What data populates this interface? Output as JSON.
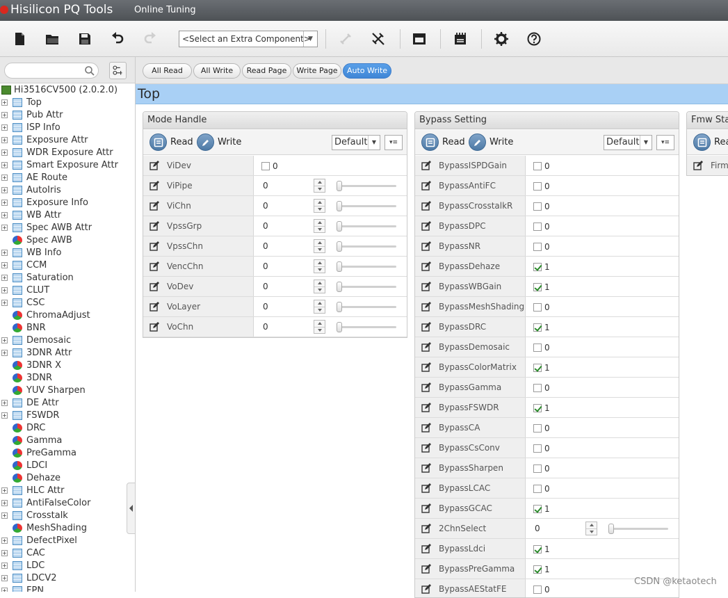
{
  "app": {
    "name": "Hisilicon PQ Tools",
    "mode": "Online Tuning"
  },
  "toolbar": {
    "icons": [
      "new-file-icon",
      "open-folder-icon",
      "save-icon",
      "undo-icon",
      "redo-icon",
      "link-icon",
      "unlink-icon",
      "window-icon",
      "register-icon",
      "gear-icon",
      "help-icon"
    ],
    "component_select": "<Select an Extra Component>"
  },
  "search": {
    "placeholder": ""
  },
  "tree": {
    "root": "Hi3516CV500 (2.0.2.0)",
    "items": [
      {
        "label": "Top",
        "icon": "grid",
        "expandable": true
      },
      {
        "label": "Pub Attr",
        "icon": "grid",
        "expandable": true
      },
      {
        "label": "ISP Info",
        "icon": "grid",
        "expandable": true
      },
      {
        "label": "Exposure Attr",
        "icon": "grid",
        "expandable": true
      },
      {
        "label": "WDR Exposure Attr",
        "icon": "grid",
        "expandable": true
      },
      {
        "label": "Smart Exposure Attr",
        "icon": "grid",
        "expandable": true
      },
      {
        "label": "AE Route",
        "icon": "grid",
        "expandable": true
      },
      {
        "label": "AutoIris",
        "icon": "grid",
        "expandable": true
      },
      {
        "label": "Exposure Info",
        "icon": "grid",
        "expandable": true
      },
      {
        "label": "WB Attr",
        "icon": "grid",
        "expandable": true
      },
      {
        "label": "Spec AWB Attr",
        "icon": "grid",
        "expandable": true
      },
      {
        "label": "Spec AWB",
        "icon": "pie",
        "expandable": false
      },
      {
        "label": "WB Info",
        "icon": "grid",
        "expandable": true
      },
      {
        "label": "CCM",
        "icon": "grid",
        "expandable": true
      },
      {
        "label": "Saturation",
        "icon": "grid",
        "expandable": true
      },
      {
        "label": "CLUT",
        "icon": "grid",
        "expandable": true
      },
      {
        "label": "CSC",
        "icon": "grid",
        "expandable": true
      },
      {
        "label": "ChromaAdjust",
        "icon": "pie",
        "expandable": false
      },
      {
        "label": "BNR",
        "icon": "pie",
        "expandable": false
      },
      {
        "label": "Demosaic",
        "icon": "grid",
        "expandable": true
      },
      {
        "label": "3DNR Attr",
        "icon": "grid",
        "expandable": true
      },
      {
        "label": "3DNR X",
        "icon": "pie",
        "expandable": false
      },
      {
        "label": "3DNR",
        "icon": "pie",
        "expandable": false
      },
      {
        "label": "YUV Sharpen",
        "icon": "pie",
        "expandable": false
      },
      {
        "label": "DE Attr",
        "icon": "grid",
        "expandable": true
      },
      {
        "label": "FSWDR",
        "icon": "grid",
        "expandable": true
      },
      {
        "label": "DRC",
        "icon": "pie",
        "expandable": false
      },
      {
        "label": "Gamma",
        "icon": "pie",
        "expandable": false
      },
      {
        "label": "PreGamma",
        "icon": "pie",
        "expandable": false
      },
      {
        "label": "LDCI",
        "icon": "pie",
        "expandable": false
      },
      {
        "label": "Dehaze",
        "icon": "pie",
        "expandable": false
      },
      {
        "label": "HLC Attr",
        "icon": "grid",
        "expandable": true
      },
      {
        "label": "AntiFalseColor",
        "icon": "grid",
        "expandable": true
      },
      {
        "label": "Crosstalk",
        "icon": "grid",
        "expandable": true
      },
      {
        "label": "MeshShading",
        "icon": "pie",
        "expandable": false
      },
      {
        "label": "DefectPixel",
        "icon": "grid",
        "expandable": true
      },
      {
        "label": "CAC",
        "icon": "grid",
        "expandable": true
      },
      {
        "label": "LDC",
        "icon": "grid",
        "expandable": true
      },
      {
        "label": "LDCV2",
        "icon": "grid",
        "expandable": true
      },
      {
        "label": "FPN",
        "icon": "grid",
        "expandable": true
      }
    ]
  },
  "actions": [
    "All Read",
    "All Write",
    "Read Page",
    "Write Page",
    "Auto Write"
  ],
  "active_action": "Auto Write",
  "section_title": "Top",
  "panels": {
    "mode_handle": {
      "title": "Mode Handle",
      "read": "Read",
      "write": "Write",
      "preset": "Default",
      "rows": [
        {
          "name": "ViDev",
          "type": "checkbox",
          "value": "0",
          "checked": false
        },
        {
          "name": "ViPipe",
          "type": "number",
          "value": "0"
        },
        {
          "name": "ViChn",
          "type": "number",
          "value": "0"
        },
        {
          "name": "VpssGrp",
          "type": "number",
          "value": "0"
        },
        {
          "name": "VpssChn",
          "type": "number",
          "value": "0"
        },
        {
          "name": "VencChn",
          "type": "number",
          "value": "0"
        },
        {
          "name": "VoDev",
          "type": "number",
          "value": "0"
        },
        {
          "name": "VoLayer",
          "type": "number",
          "value": "0"
        },
        {
          "name": "VoChn",
          "type": "number",
          "value": "0"
        }
      ]
    },
    "bypass": {
      "title": "Bypass Setting",
      "read": "Read",
      "write": "Write",
      "preset": "Default",
      "rows": [
        {
          "name": "BypassISPDGain",
          "type": "checkbox",
          "value": "0",
          "checked": false
        },
        {
          "name": "BypassAntiFC",
          "type": "checkbox",
          "value": "0",
          "checked": false
        },
        {
          "name": "BypassCrosstalkR",
          "type": "checkbox",
          "value": "0",
          "checked": false
        },
        {
          "name": "BypassDPC",
          "type": "checkbox",
          "value": "0",
          "checked": false
        },
        {
          "name": "BypassNR",
          "type": "checkbox",
          "value": "0",
          "checked": false
        },
        {
          "name": "BypassDehaze",
          "type": "checkbox",
          "value": "1",
          "checked": true
        },
        {
          "name": "BypassWBGain",
          "type": "checkbox",
          "value": "1",
          "checked": true
        },
        {
          "name": "BypassMeshShading",
          "type": "checkbox",
          "value": "0",
          "checked": false
        },
        {
          "name": "BypassDRC",
          "type": "checkbox",
          "value": "1",
          "checked": true
        },
        {
          "name": "BypassDemosaic",
          "type": "checkbox",
          "value": "0",
          "checked": false
        },
        {
          "name": "BypassColorMatrix",
          "type": "checkbox",
          "value": "1",
          "checked": true
        },
        {
          "name": "BypassGamma",
          "type": "checkbox",
          "value": "0",
          "checked": false
        },
        {
          "name": "BypassFSWDR",
          "type": "checkbox",
          "value": "1",
          "checked": true
        },
        {
          "name": "BypassCA",
          "type": "checkbox",
          "value": "0",
          "checked": false
        },
        {
          "name": "BypassCsConv",
          "type": "checkbox",
          "value": "0",
          "checked": false
        },
        {
          "name": "BypassSharpen",
          "type": "checkbox",
          "value": "0",
          "checked": false
        },
        {
          "name": "BypassLCAC",
          "type": "checkbox",
          "value": "0",
          "checked": false
        },
        {
          "name": "BypassGCAC",
          "type": "checkbox",
          "value": "1",
          "checked": true
        },
        {
          "name": "2ChnSelect",
          "type": "number",
          "value": "0"
        },
        {
          "name": "BypassLdci",
          "type": "checkbox",
          "value": "1",
          "checked": true
        },
        {
          "name": "BypassPreGamma",
          "type": "checkbox",
          "value": "1",
          "checked": true
        },
        {
          "name": "BypassAEStatFE",
          "type": "checkbox",
          "value": "0",
          "checked": false
        }
      ]
    },
    "fmw": {
      "title": "Fmw Stat",
      "read": "Rea",
      "row": "Firm"
    }
  },
  "watermark": "CSDN @ketaotech",
  "colors": {
    "section_bar": "#a9d0f5",
    "active_button": "#4a90e2",
    "titlebar": "#5b5f63"
  }
}
